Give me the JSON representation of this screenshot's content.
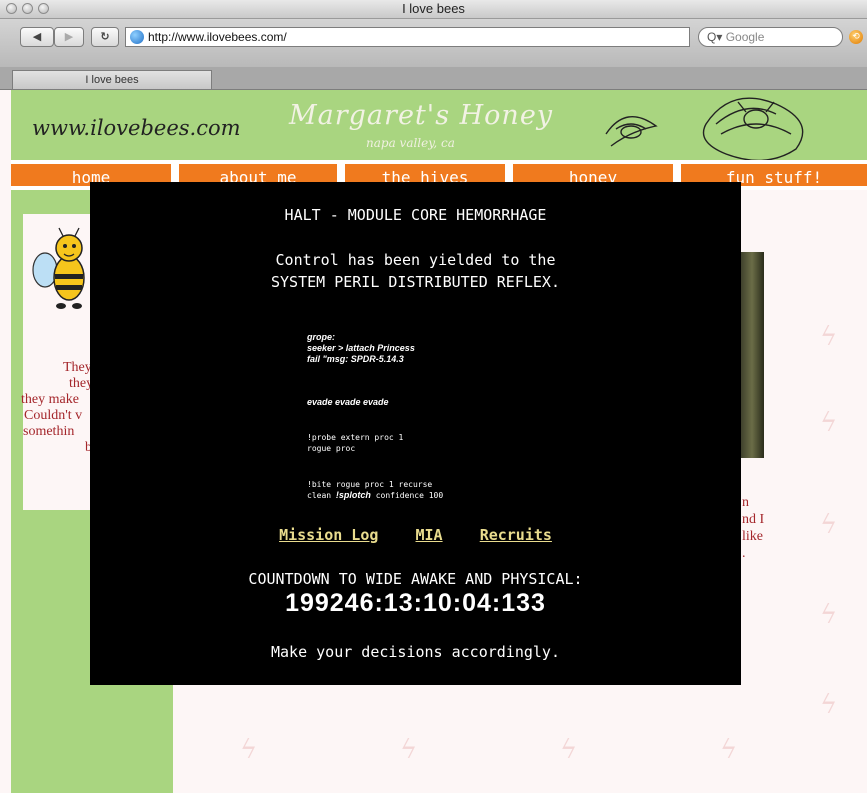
{
  "window": {
    "title": "I love bees"
  },
  "toolbar": {
    "back_icon": "back-arrow-icon",
    "forward_icon": "forward-arrow-icon",
    "reload_icon": "reload-icon",
    "url": "http://www.ilovebees.com/",
    "search_placeholder": "Google",
    "search_prefix": "Q▾"
  },
  "tabs": [
    {
      "label": "I love bees"
    }
  ],
  "site": {
    "url_text": "www.ilovebees.com",
    "brand": "Margaret's Honey",
    "brand_sub": "napa valley, ca",
    "nav": [
      {
        "label": "home"
      },
      {
        "label": "about me"
      },
      {
        "label": "the hives"
      },
      {
        "label": "honey"
      },
      {
        "label": "fun stuff!"
      }
    ],
    "sidebar_lines": [
      "They",
      "they",
      "they make",
      "Couldn't v",
      "somethin",
      "be"
    ],
    "right_lines": [
      "n",
      "nd I",
      "like",
      "."
    ]
  },
  "overlay": {
    "halt": "HALT - MODULE CORE HEMORRHAGE",
    "control_line1": "Control has been yielded to the",
    "control_line2": "SYSTEM PERIL DISTRIBUTED REFLEX.",
    "grope_lines": [
      "grope:",
      "seeker > lattach Princess",
      "fail \"msg: SPDR-5.14.3"
    ],
    "evade": "evade evade evade",
    "probe_lines": [
      "!probe extern proc 1",
      "rogue proc"
    ],
    "bite_line": "!bite rogue proc 1 recurse",
    "clean_prefix": "clean ",
    "clean_splotch": "!splotch",
    "clean_suffix": " confidence 100",
    "links": [
      {
        "label": "Mission Log"
      },
      {
        "label": "MIA"
      },
      {
        "label": "Recruits"
      }
    ],
    "countdown_label": "COUNTDOWN TO WIDE AWAKE AND PHYSICAL:",
    "countdown_value": "199246:13:10:04:133",
    "decisions": "Make your decisions accordingly."
  },
  "colors": {
    "header_green": "#a9d580",
    "nav_orange": "#f07a1e",
    "overlay_black": "#000000",
    "link_yellow": "#e9dc8e",
    "text_red": "#a4262b"
  }
}
